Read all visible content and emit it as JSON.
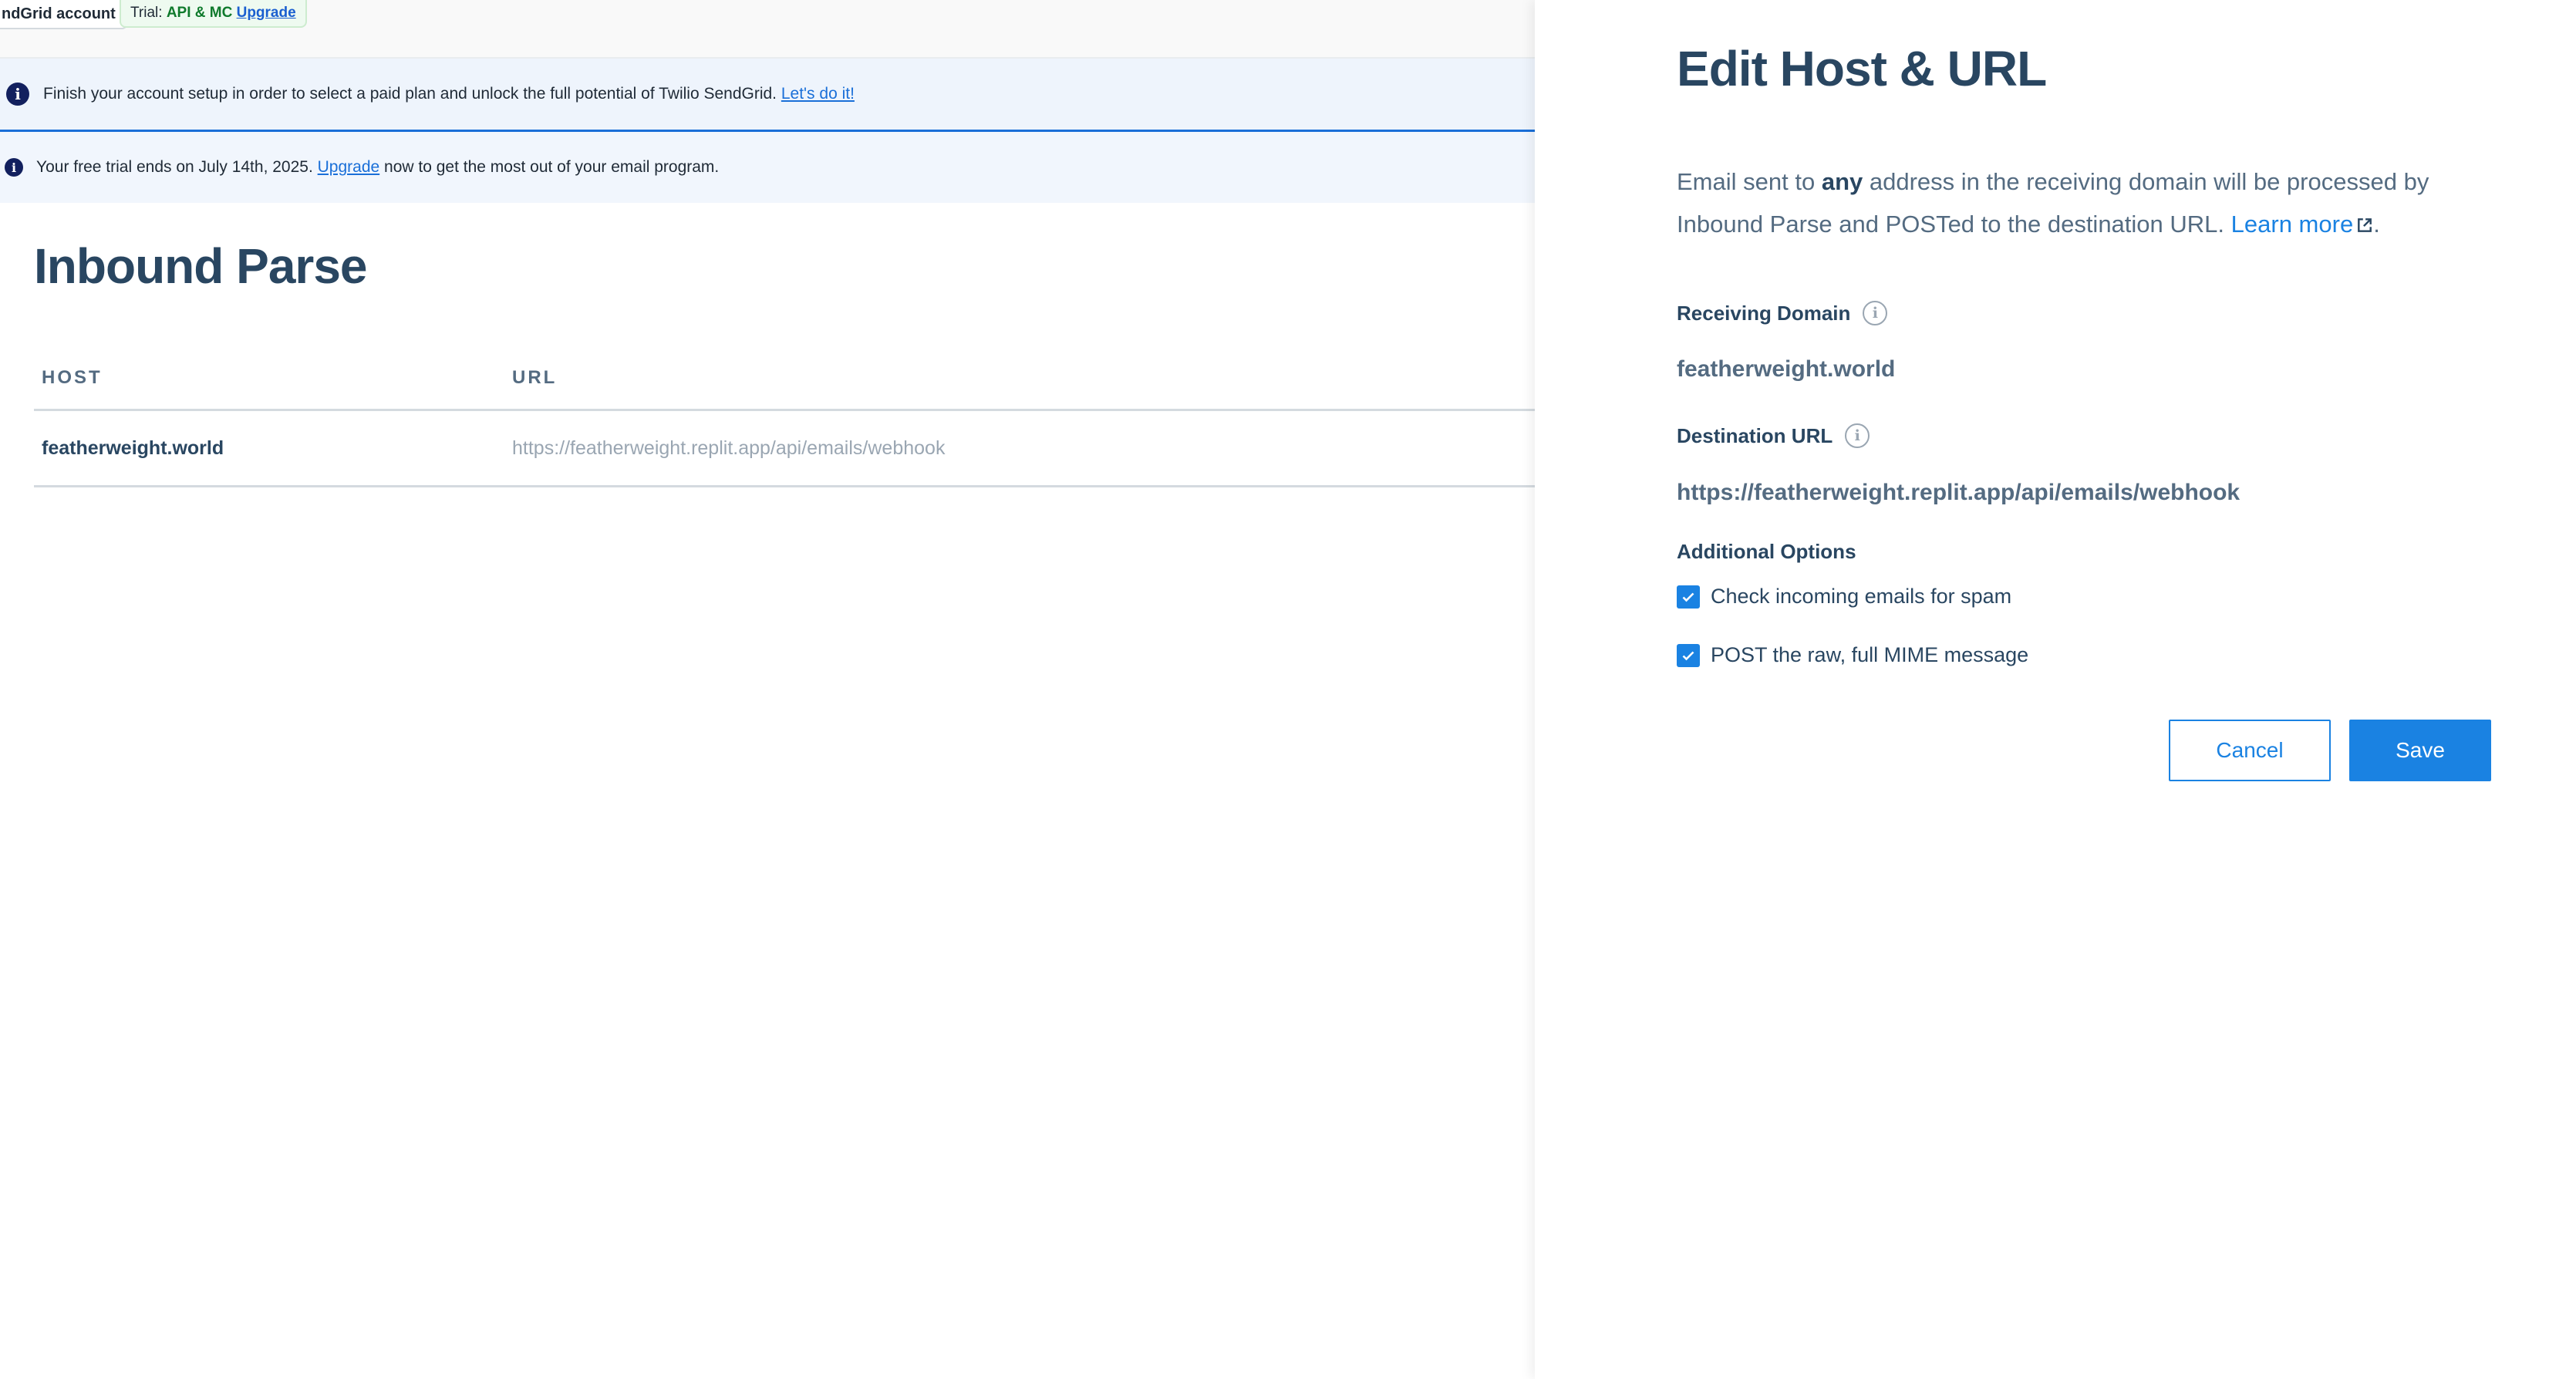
{
  "topbar": {
    "account_label": "ndGrid account",
    "trial_prefix": "Trial:",
    "trial_plan": "API & MC",
    "trial_upgrade": "Upgrade"
  },
  "banners": {
    "setup": {
      "text": "Finish your account setup in order to select a paid plan and unlock the full potential of Twilio SendGrid.",
      "link": "Let's do it!"
    },
    "trial": {
      "text_before": "Your free trial ends on July 14th, 2025.",
      "link": "Upgrade",
      "text_after": "now to get the most out of your email program."
    }
  },
  "page": {
    "title": "Inbound Parse",
    "columns": {
      "host": "HOST",
      "url": "URL"
    },
    "rows": [
      {
        "host": "featherweight.world",
        "url": "https://featherweight.replit.app/api/emails/webhook"
      }
    ]
  },
  "panel": {
    "title": "Edit Host & URL",
    "desc_1": "Email sent to",
    "desc_bold": "any",
    "desc_2": "address in the receiving domain will be processed by Inbound Parse and POSTed to the destination URL.",
    "learn_more": "Learn more",
    "desc_end": ".",
    "receiving_domain_label": "Receiving Domain",
    "receiving_domain_value": "featherweight.world",
    "destination_url_label": "Destination URL",
    "destination_url_value": "https://featherweight.replit.app/api/emails/webhook",
    "additional_options_label": "Additional Options",
    "options": [
      {
        "label": "Check incoming emails for spam",
        "checked": true
      },
      {
        "label": "POST the raw, full MIME message",
        "checked": true
      }
    ],
    "cancel_label": "Cancel",
    "save_label": "Save"
  },
  "colors": {
    "accent": "#1a82e2",
    "heading": "#294661",
    "muted": "#546b81",
    "banner_info": "#12205e"
  },
  "icons": {
    "info": "info-circle-icon",
    "help": "help-circle-icon",
    "external": "external-link-icon",
    "check": "checkmark-icon"
  }
}
